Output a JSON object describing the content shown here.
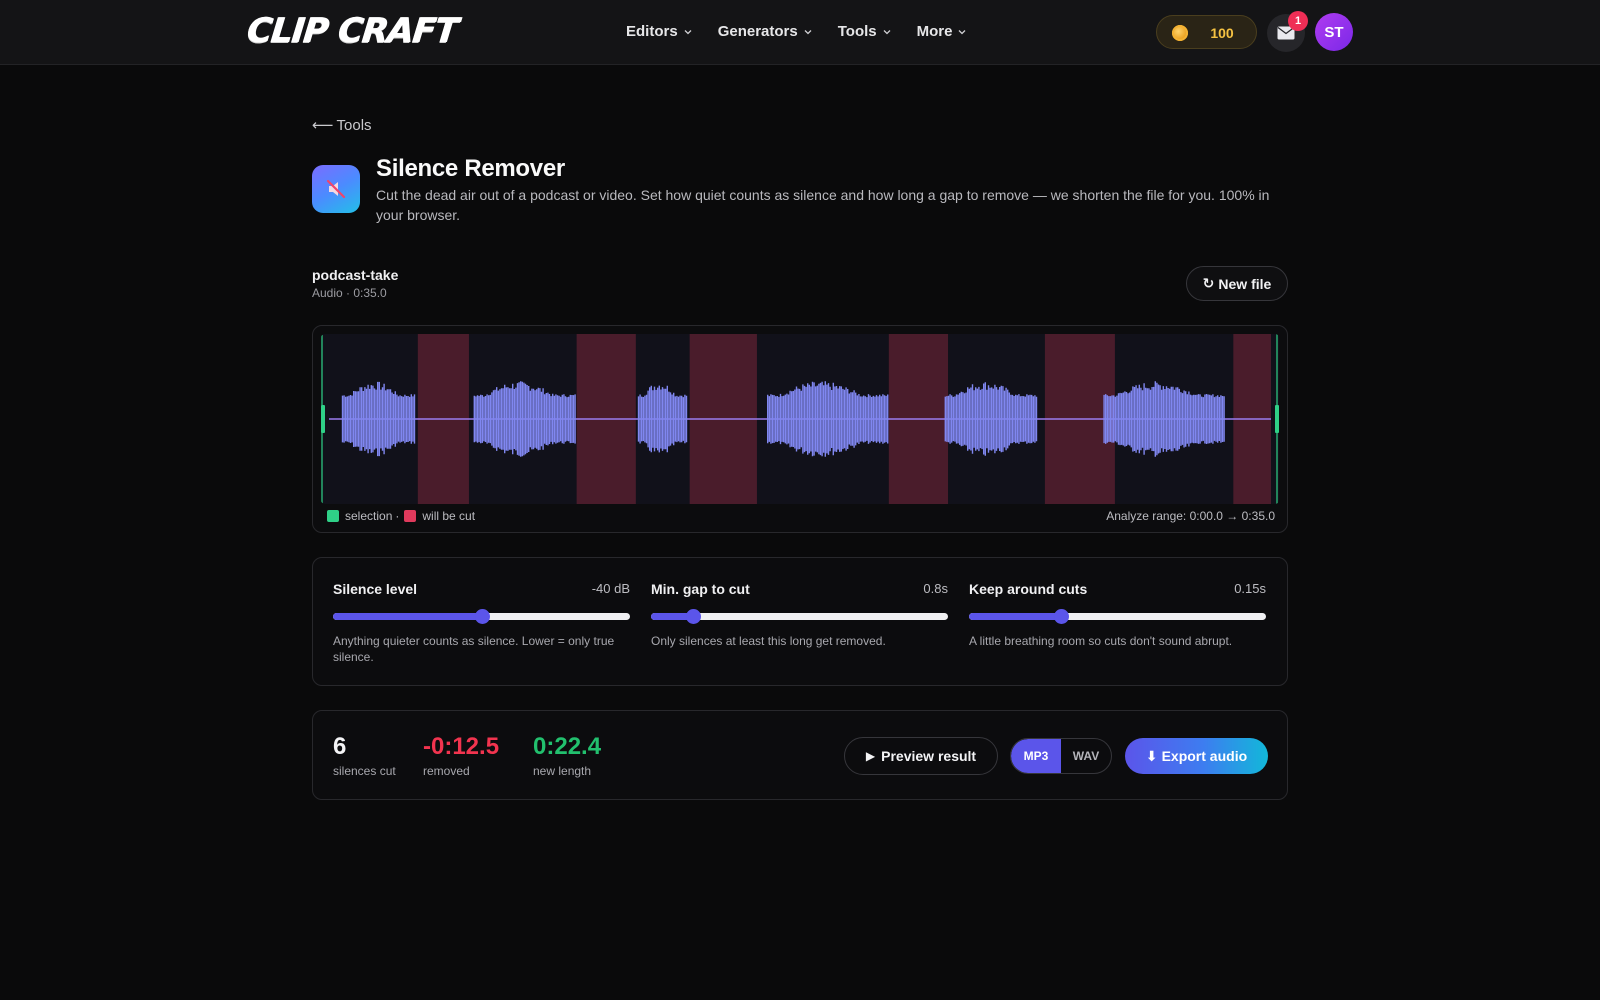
{
  "nav": {
    "logo": "CLIP CRAFT",
    "menu": [
      {
        "label": "Editors"
      },
      {
        "label": "Generators"
      },
      {
        "label": "Tools"
      },
      {
        "label": "More"
      }
    ],
    "coins": "100",
    "notifications": "1",
    "avatar_initials": "ST"
  },
  "header": {
    "back_label": "Tools",
    "title": "Silence Remover",
    "description": "Cut the dead air out of a podcast or video. Set how quiet counts as silence and how long a gap to remove — we shorten the file for you. 100% in your browser."
  },
  "file": {
    "name": "podcast-take",
    "meta": "Audio · 0:35.0",
    "new_file_label": "New file"
  },
  "waveform": {
    "duration_s": 35.0,
    "speech_segments_s": [
      [
        0.5,
        3.2
      ],
      [
        5.4,
        9.2
      ],
      [
        11.5,
        13.3
      ],
      [
        16.3,
        20.8
      ],
      [
        22.9,
        26.3
      ],
      [
        28.8,
        33.3
      ]
    ],
    "cut_segments_s": [
      [
        3.3,
        5.2
      ],
      [
        9.2,
        11.4
      ],
      [
        13.4,
        15.9
      ],
      [
        20.8,
        23.0
      ],
      [
        26.6,
        29.2
      ],
      [
        33.6,
        35.0
      ]
    ],
    "legend": {
      "selection": "selection",
      "separator": "·",
      "cut": "will be cut"
    },
    "range_label": "Analyze range: 0:00.0 → 0:35.0",
    "colors": {
      "wave": "#8087f0",
      "cut": "#4a1c2b",
      "selection": "#2fd087",
      "baseline": "#9a7cf0"
    }
  },
  "controls": [
    {
      "label": "Silence level",
      "value": "-40 dB",
      "fraction": 0.5,
      "help": "Anything quieter counts as silence. Lower = only true silence."
    },
    {
      "label": "Min. gap to cut",
      "value": "0.8s",
      "fraction": 0.14,
      "help": "Only silences at least this long get removed."
    },
    {
      "label": "Keep around cuts",
      "value": "0.15s",
      "fraction": 0.31,
      "help": "A little breathing room so cuts don't sound abrupt."
    }
  ],
  "stats": {
    "silences_cut": {
      "value": "6",
      "label": "silences cut",
      "color": "#f4f4f6"
    },
    "removed": {
      "value": "-0:12.5",
      "label": "removed",
      "color": "#f2344f"
    },
    "new_length": {
      "value": "0:22.4",
      "label": "new length",
      "color": "#22c06e"
    }
  },
  "actions": {
    "preview_label": "Preview result",
    "formats": [
      "MP3",
      "WAV"
    ],
    "selected_format": "MP3",
    "export_label": "Export audio"
  }
}
